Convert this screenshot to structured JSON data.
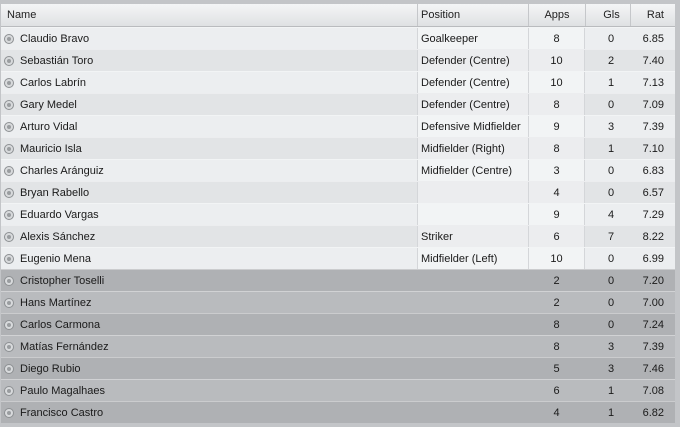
{
  "columns": {
    "name": "Name",
    "position": "Position",
    "apps": "Apps",
    "goals": "Gls",
    "rating": "Rat"
  },
  "players": [
    {
      "name": "Claudio Bravo",
      "position": "Goalkeeper",
      "apps": "8",
      "goals": "0",
      "rating": "6.85",
      "group": "light"
    },
    {
      "name": "Sebastián Toro",
      "position": "Defender (Centre)",
      "apps": "10",
      "goals": "2",
      "rating": "7.40",
      "group": "light"
    },
    {
      "name": "Carlos Labrín",
      "position": "Defender (Centre)",
      "apps": "10",
      "goals": "1",
      "rating": "7.13",
      "group": "light"
    },
    {
      "name": "Gary Medel",
      "position": "Defender (Centre)",
      "apps": "8",
      "goals": "0",
      "rating": "7.09",
      "group": "light"
    },
    {
      "name": "Arturo Vidal",
      "position": "Defensive Midfielder",
      "apps": "9",
      "goals": "3",
      "rating": "7.39",
      "group": "light"
    },
    {
      "name": "Mauricio Isla",
      "position": "Midfielder (Right)",
      "apps": "8",
      "goals": "1",
      "rating": "7.10",
      "group": "light"
    },
    {
      "name": "Charles Aránguiz",
      "position": "Midfielder (Centre)",
      "apps": "3",
      "goals": "0",
      "rating": "6.83",
      "group": "light"
    },
    {
      "name": "Bryan Rabello",
      "position": "",
      "apps": "4",
      "goals": "0",
      "rating": "6.57",
      "group": "light"
    },
    {
      "name": "Eduardo Vargas",
      "position": "",
      "apps": "9",
      "goals": "4",
      "rating": "7.29",
      "group": "light"
    },
    {
      "name": "Alexis Sánchez",
      "position": "Striker",
      "apps": "6",
      "goals": "7",
      "rating": "8.22",
      "group": "light"
    },
    {
      "name": "Eugenio Mena",
      "position": "Midfielder (Left)",
      "apps": "10",
      "goals": "0",
      "rating": "6.99",
      "group": "light"
    },
    {
      "name": "Cristopher Toselli",
      "position": "",
      "apps": "2",
      "goals": "0",
      "rating": "7.20",
      "group": "dark"
    },
    {
      "name": "Hans Martínez",
      "position": "",
      "apps": "2",
      "goals": "0",
      "rating": "7.00",
      "group": "dark"
    },
    {
      "name": "Carlos Carmona",
      "position": "",
      "apps": "8",
      "goals": "0",
      "rating": "7.24",
      "group": "dark"
    },
    {
      "name": "Matías Fernández",
      "position": "",
      "apps": "8",
      "goals": "3",
      "rating": "7.39",
      "group": "dark"
    },
    {
      "name": "Diego Rubio",
      "position": "",
      "apps": "5",
      "goals": "3",
      "rating": "7.46",
      "group": "dark"
    },
    {
      "name": "Paulo Magalhaes",
      "position": "",
      "apps": "6",
      "goals": "1",
      "rating": "7.08",
      "group": "dark"
    },
    {
      "name": "Francisco Castro",
      "position": "",
      "apps": "4",
      "goals": "1",
      "rating": "6.82",
      "group": "dark"
    }
  ]
}
